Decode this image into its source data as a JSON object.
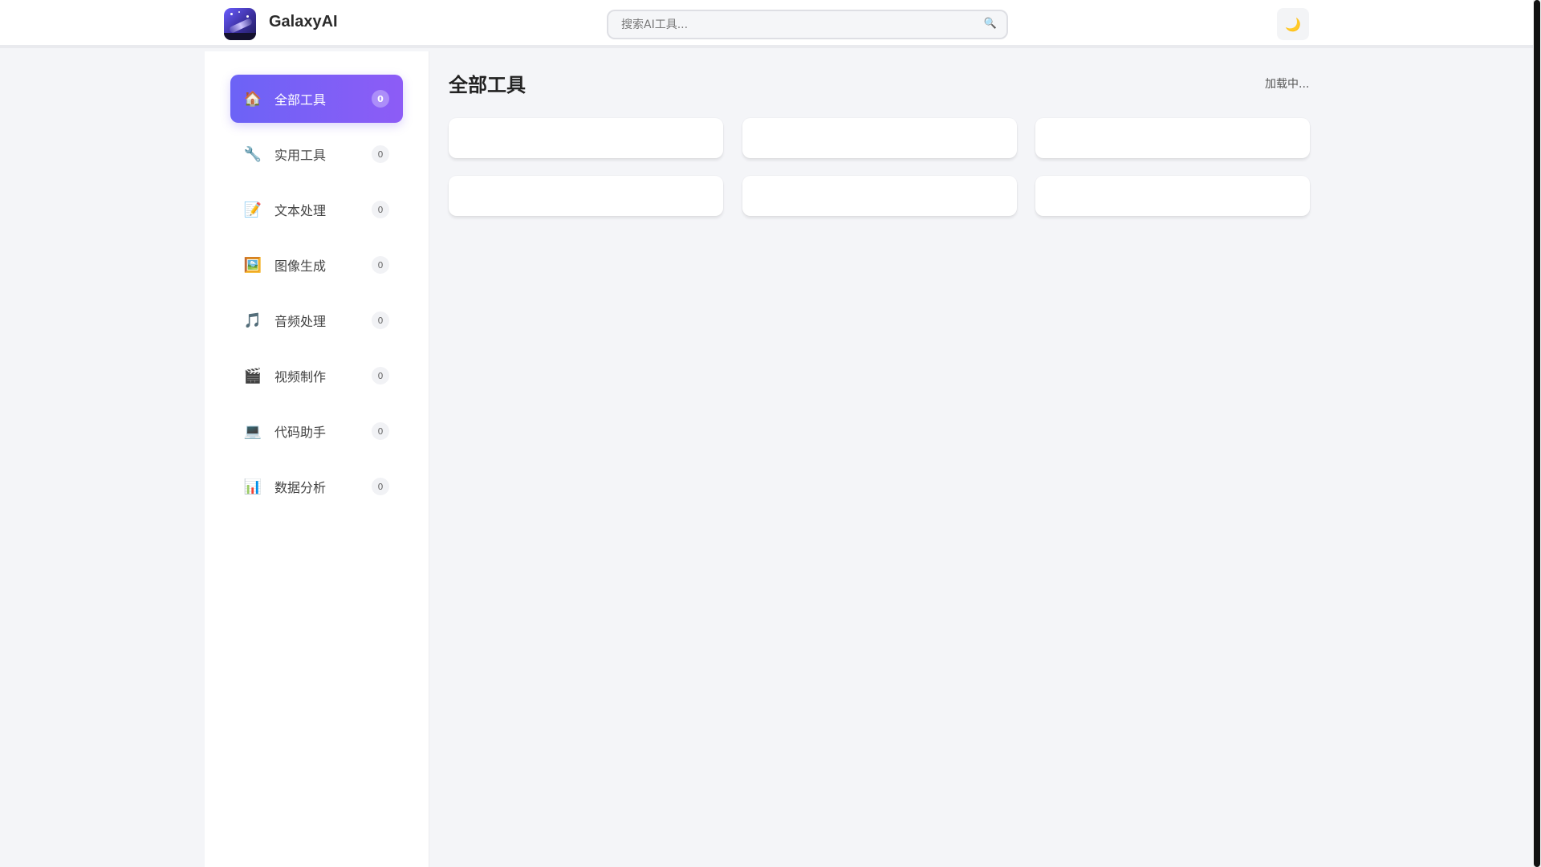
{
  "header": {
    "brand": "GalaxyAI",
    "search_placeholder": "搜索AI工具...",
    "search_icon": "search-icon",
    "theme_icon": "moon-icon",
    "theme_glyph": "🌙",
    "search_glyph": "🔍"
  },
  "sidebar": {
    "items": [
      {
        "label": "全部工具",
        "count": "0",
        "icon": "home-icon",
        "glyph": "🏠"
      },
      {
        "label": "实用工具",
        "count": "0",
        "icon": "wrench-icon",
        "glyph": "🔧"
      },
      {
        "label": "文本处理",
        "count": "0",
        "icon": "memo-icon",
        "glyph": "📝"
      },
      {
        "label": "图像生成",
        "count": "0",
        "icon": "picture-icon",
        "glyph": "🖼️"
      },
      {
        "label": "音频处理",
        "count": "0",
        "icon": "music-note-icon",
        "glyph": "🎵"
      },
      {
        "label": "视频制作",
        "count": "0",
        "icon": "clapper-icon",
        "glyph": "🎬"
      },
      {
        "label": "代码助手",
        "count": "0",
        "icon": "laptop-icon",
        "glyph": "💻"
      },
      {
        "label": "数据分析",
        "count": "0",
        "icon": "bar-chart-icon",
        "glyph": "📊"
      }
    ]
  },
  "main": {
    "title": "全部工具",
    "status": "加载中..."
  },
  "colors": {
    "accent_start": "#6c63f6",
    "accent_end": "#8d5cf6",
    "background": "#f4f5f8"
  }
}
